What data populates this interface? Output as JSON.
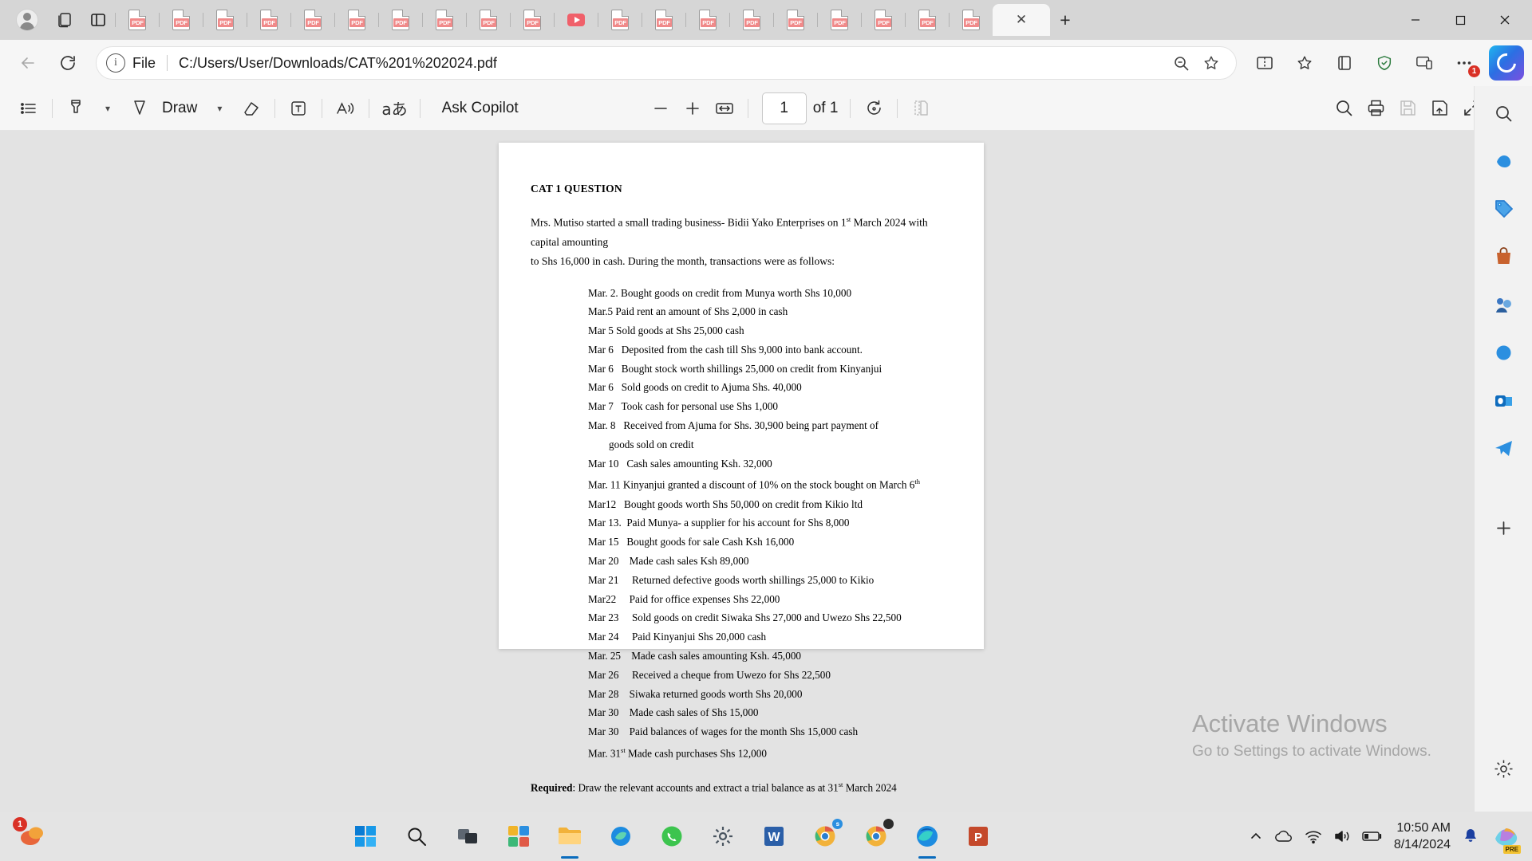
{
  "browser": {
    "tabs": [
      {
        "type": "pdf",
        "active": false
      },
      {
        "type": "pdf",
        "active": false
      },
      {
        "type": "pdf",
        "active": false
      },
      {
        "type": "pdf",
        "active": false
      },
      {
        "type": "pdf",
        "active": false
      },
      {
        "type": "pdf",
        "active": false
      },
      {
        "type": "pdf",
        "active": false
      },
      {
        "type": "pdf",
        "active": false
      },
      {
        "type": "pdf",
        "active": false
      },
      {
        "type": "pdf",
        "active": false
      },
      {
        "type": "video",
        "active": false
      },
      {
        "type": "pdf",
        "active": false
      },
      {
        "type": "pdf",
        "active": false
      },
      {
        "type": "pdf",
        "active": false
      },
      {
        "type": "pdf",
        "active": false
      },
      {
        "type": "pdf",
        "active": false
      },
      {
        "type": "pdf",
        "active": false
      },
      {
        "type": "pdf",
        "active": false
      },
      {
        "type": "pdf",
        "active": false
      },
      {
        "type": "pdf",
        "active": false
      },
      {
        "type": "pdf",
        "active": true
      }
    ],
    "new_tab_label": "+",
    "window_controls": {
      "minimize": "—",
      "maximize": "☐",
      "close": "✕"
    },
    "omnibox": {
      "scheme_label": "File",
      "url": "C:/Users/User/Downloads/CAT%201%202024.pdf",
      "info_glyph": "i"
    },
    "copilot_badge": "1"
  },
  "pdf_toolbar": {
    "draw_label": "Draw",
    "ask_copilot_label": "Ask Copilot",
    "zoom_out": "−",
    "zoom_in": "+",
    "page_number": "1",
    "page_total": "of 1",
    "chevron": "⌄"
  },
  "document": {
    "title": "CAT 1 QUESTION",
    "intro_line1_a": "Mrs. Mutiso started a small trading business- Bidii Yako Enterprises on 1",
    "intro_line1_sup": "st",
    "intro_line1_b": " March 2024 with capital amounting",
    "intro_line2": "to Shs 16,000 in cash. During the month, transactions were as follows:",
    "transactions": [
      "Mar. 2. Bought goods on credit from Munya worth Shs 10,000",
      "Mar.5 Paid rent an amount of Shs 2,000 in cash",
      "Mar 5 Sold goods at Shs 25,000 cash",
      "Mar 6   Deposited from the cash till Shs 9,000 into bank account.",
      "Mar 6   Bought stock worth shillings 25,000 on credit from Kinyanjui",
      "Mar 6   Sold goods on credit to Ajuma Shs. 40,000",
      "Mar 7   Took cash for personal use Shs 1,000",
      "Mar. 8   Received from Ajuma for Shs. 30,900 being part payment of",
      "Mar 10   Cash sales amounting Ksh. 32,000",
      "Mar12   Bought goods worth Shs 50,000 on credit from Kikio ltd",
      "Mar 13.  Paid Munya- a supplier for his account for Shs 8,000",
      "Mar 15   Bought goods for sale Cash Ksh 16,000",
      "Mar 20    Made cash sales Ksh 89,000",
      "Mar 21     Returned defective goods worth shillings 25,000 to Kikio",
      "Mar22     Paid for office expenses Shs 22,000",
      "Mar 23     Sold goods on credit Siwaka Shs 27,000 and Uwezo Shs 22,500",
      "Mar 24     Paid Kinyanjui Shs 20,000 cash",
      "Mar. 25    Made cash sales amounting Ksh. 45,000",
      "Mar 26     Received a cheque from Uwezo for Shs 22,500",
      "Mar 28    Siwaka returned goods worth Shs 20,000",
      "Mar 30    Made cash sales of Shs 15,000",
      "Mar 30    Paid balances of wages for the month Shs 15,000 cash"
    ],
    "continuation_line": "goods sold on credit",
    "discount_line_a": "Mar. 11 Kinyanjui granted a discount of 10% on the stock bought on March 6",
    "discount_line_sup": "th",
    "last_line_a": "Mar. 31",
    "last_line_sup": "st",
    "last_line_b": " Made cash purchases Shs 12,000",
    "required_label": "Required",
    "required_text_a": ":  Draw the relevant accounts and extract a trial balance as at 31",
    "required_sup": "st",
    "required_text_b": " March 2024"
  },
  "sidebar": {
    "items": [
      {
        "name": "copilot-sidebar-icon"
      },
      {
        "name": "shopping-tag-icon"
      },
      {
        "name": "shopping-bag-icon"
      },
      {
        "name": "split-screen-icon"
      },
      {
        "name": "browser-essentials-icon"
      },
      {
        "name": "outlook-icon"
      },
      {
        "name": "telegram-icon"
      },
      {
        "name": "add-tool-icon"
      },
      {
        "name": "settings-gear-icon"
      }
    ]
  },
  "watermark": {
    "title": "Activate Windows",
    "subtitle": "Go to Settings to activate Windows."
  },
  "taskbar": {
    "apps": [
      {
        "name": "start-button"
      },
      {
        "name": "search-button"
      },
      {
        "name": "task-view-button"
      },
      {
        "name": "widgets-button"
      },
      {
        "name": "file-explorer-button"
      },
      {
        "name": "edge-copilot-button"
      },
      {
        "name": "whatsapp-button"
      },
      {
        "name": "settings-button"
      },
      {
        "name": "word-button"
      },
      {
        "name": "chrome-button"
      },
      {
        "name": "chrome-2-button"
      },
      {
        "name": "edge-button"
      },
      {
        "name": "powerpoint-button"
      }
    ],
    "time": "10:50 AM",
    "date": "8/14/2024",
    "notification_badge": "1",
    "copilot_badge": "PRE"
  },
  "colors": {
    "accent_blue": "#0a6cbd",
    "pdf_red": "#f08a8a",
    "badge_red": "#d93025",
    "taskbar_bg": "#e4e4e4",
    "viewer_bg": "#e3e3e3"
  }
}
